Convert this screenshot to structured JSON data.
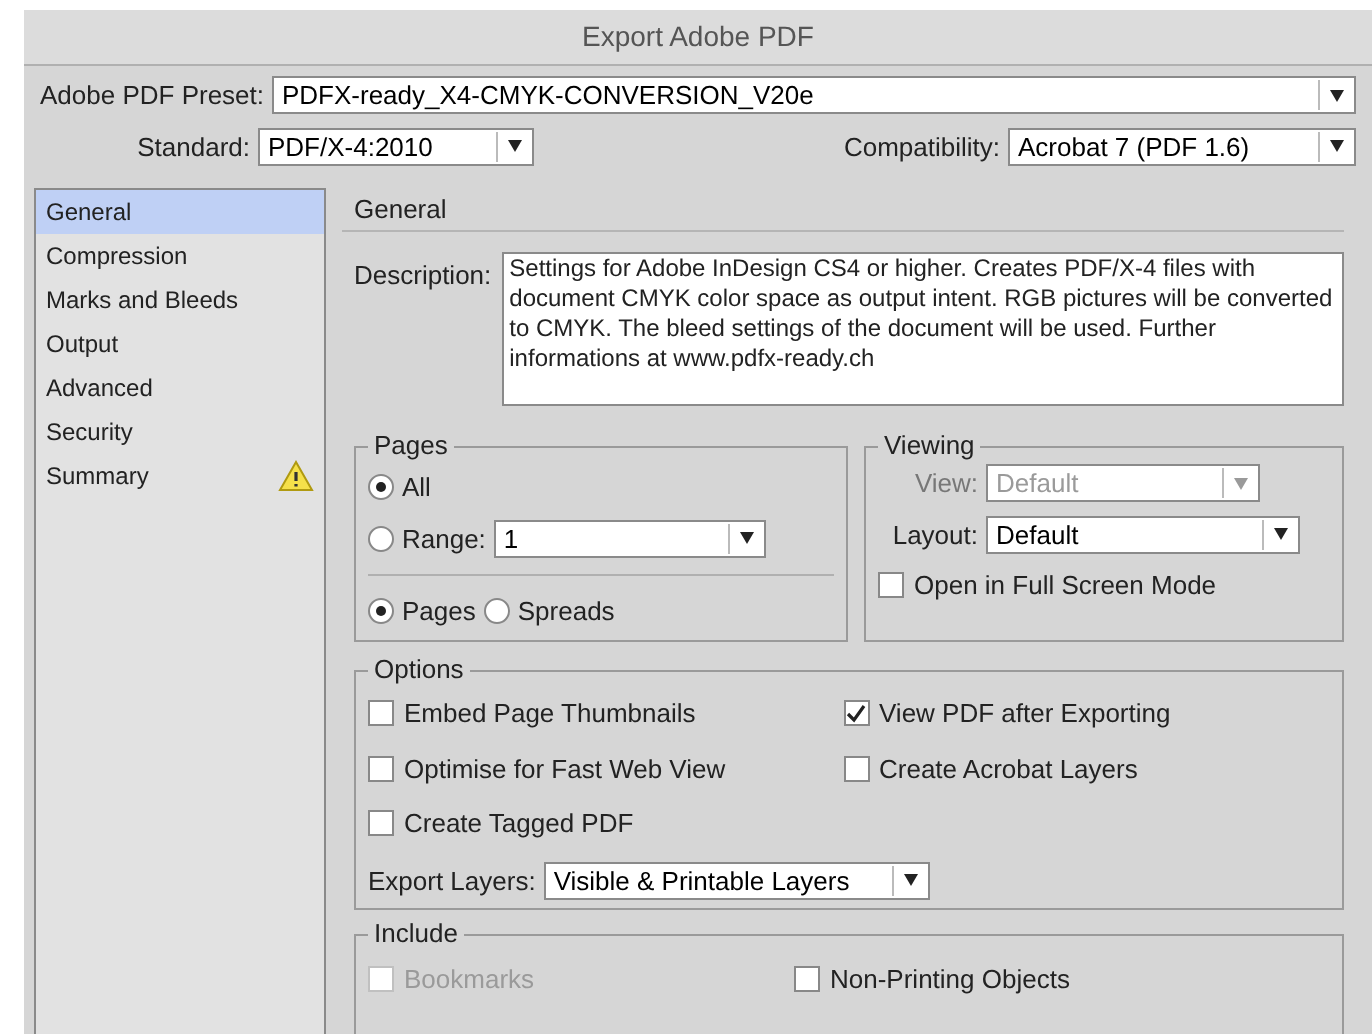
{
  "window": {
    "title": "Export Adobe PDF"
  },
  "preset": {
    "label": "Adobe PDF Preset:",
    "value": "PDFX-ready_X4-CMYK-CONVERSION_V20e"
  },
  "standard": {
    "label": "Standard:",
    "value": "PDF/X-4:2010"
  },
  "compatibility": {
    "label": "Compatibility:",
    "value": "Acrobat 7 (PDF 1.6)"
  },
  "sidebar": {
    "items": [
      {
        "label": "General",
        "selected": true,
        "warning": false
      },
      {
        "label": "Compression",
        "selected": false,
        "warning": false
      },
      {
        "label": "Marks and Bleeds",
        "selected": false,
        "warning": false
      },
      {
        "label": "Output",
        "selected": false,
        "warning": false
      },
      {
        "label": "Advanced",
        "selected": false,
        "warning": false
      },
      {
        "label": "Security",
        "selected": false,
        "warning": false
      },
      {
        "label": "Summary",
        "selected": false,
        "warning": true
      }
    ]
  },
  "section_title": "General",
  "description": {
    "label": "Description:",
    "value": "Settings for Adobe InDesign CS4 or higher. Creates PDF/X-4 files with document CMYK color space as output intent. RGB pictures will be converted to CMYK. The bleed settings of the document will be used. Further informations at www.pdfx-ready.ch"
  },
  "pages": {
    "title": "Pages",
    "all": {
      "label": "All",
      "selected": true
    },
    "range": {
      "label": "Range:",
      "selected": false,
      "value": "1"
    },
    "mode": [
      {
        "label": "Pages",
        "selected": true
      },
      {
        "label": "Spreads",
        "selected": false
      }
    ]
  },
  "viewing": {
    "title": "Viewing",
    "view": {
      "label": "View:",
      "value": "Default",
      "disabled": true
    },
    "layout": {
      "label": "Layout:",
      "value": "Default",
      "disabled": false
    },
    "full_screen": {
      "label": "Open in Full Screen Mode",
      "checked": false,
      "disabled": false
    }
  },
  "options": {
    "title": "Options",
    "checkboxes": [
      {
        "label": "Embed Page Thumbnails",
        "checked": false,
        "disabled": false
      },
      {
        "label": "View PDF after Exporting",
        "checked": true,
        "disabled": false
      },
      {
        "label": "Optimise for Fast Web View",
        "checked": false,
        "disabled": false
      },
      {
        "label": "Create Acrobat Layers",
        "checked": false,
        "disabled": false
      },
      {
        "label": "Create Tagged PDF",
        "checked": false,
        "disabled": false
      }
    ],
    "export_layers": {
      "label": "Export Layers:",
      "value": "Visible & Printable Layers"
    }
  },
  "include": {
    "title": "Include",
    "checkboxes": [
      {
        "label": "Bookmarks",
        "checked": false,
        "disabled": true
      },
      {
        "label": "Non-Printing Objects",
        "checked": false,
        "disabled": false
      }
    ]
  }
}
